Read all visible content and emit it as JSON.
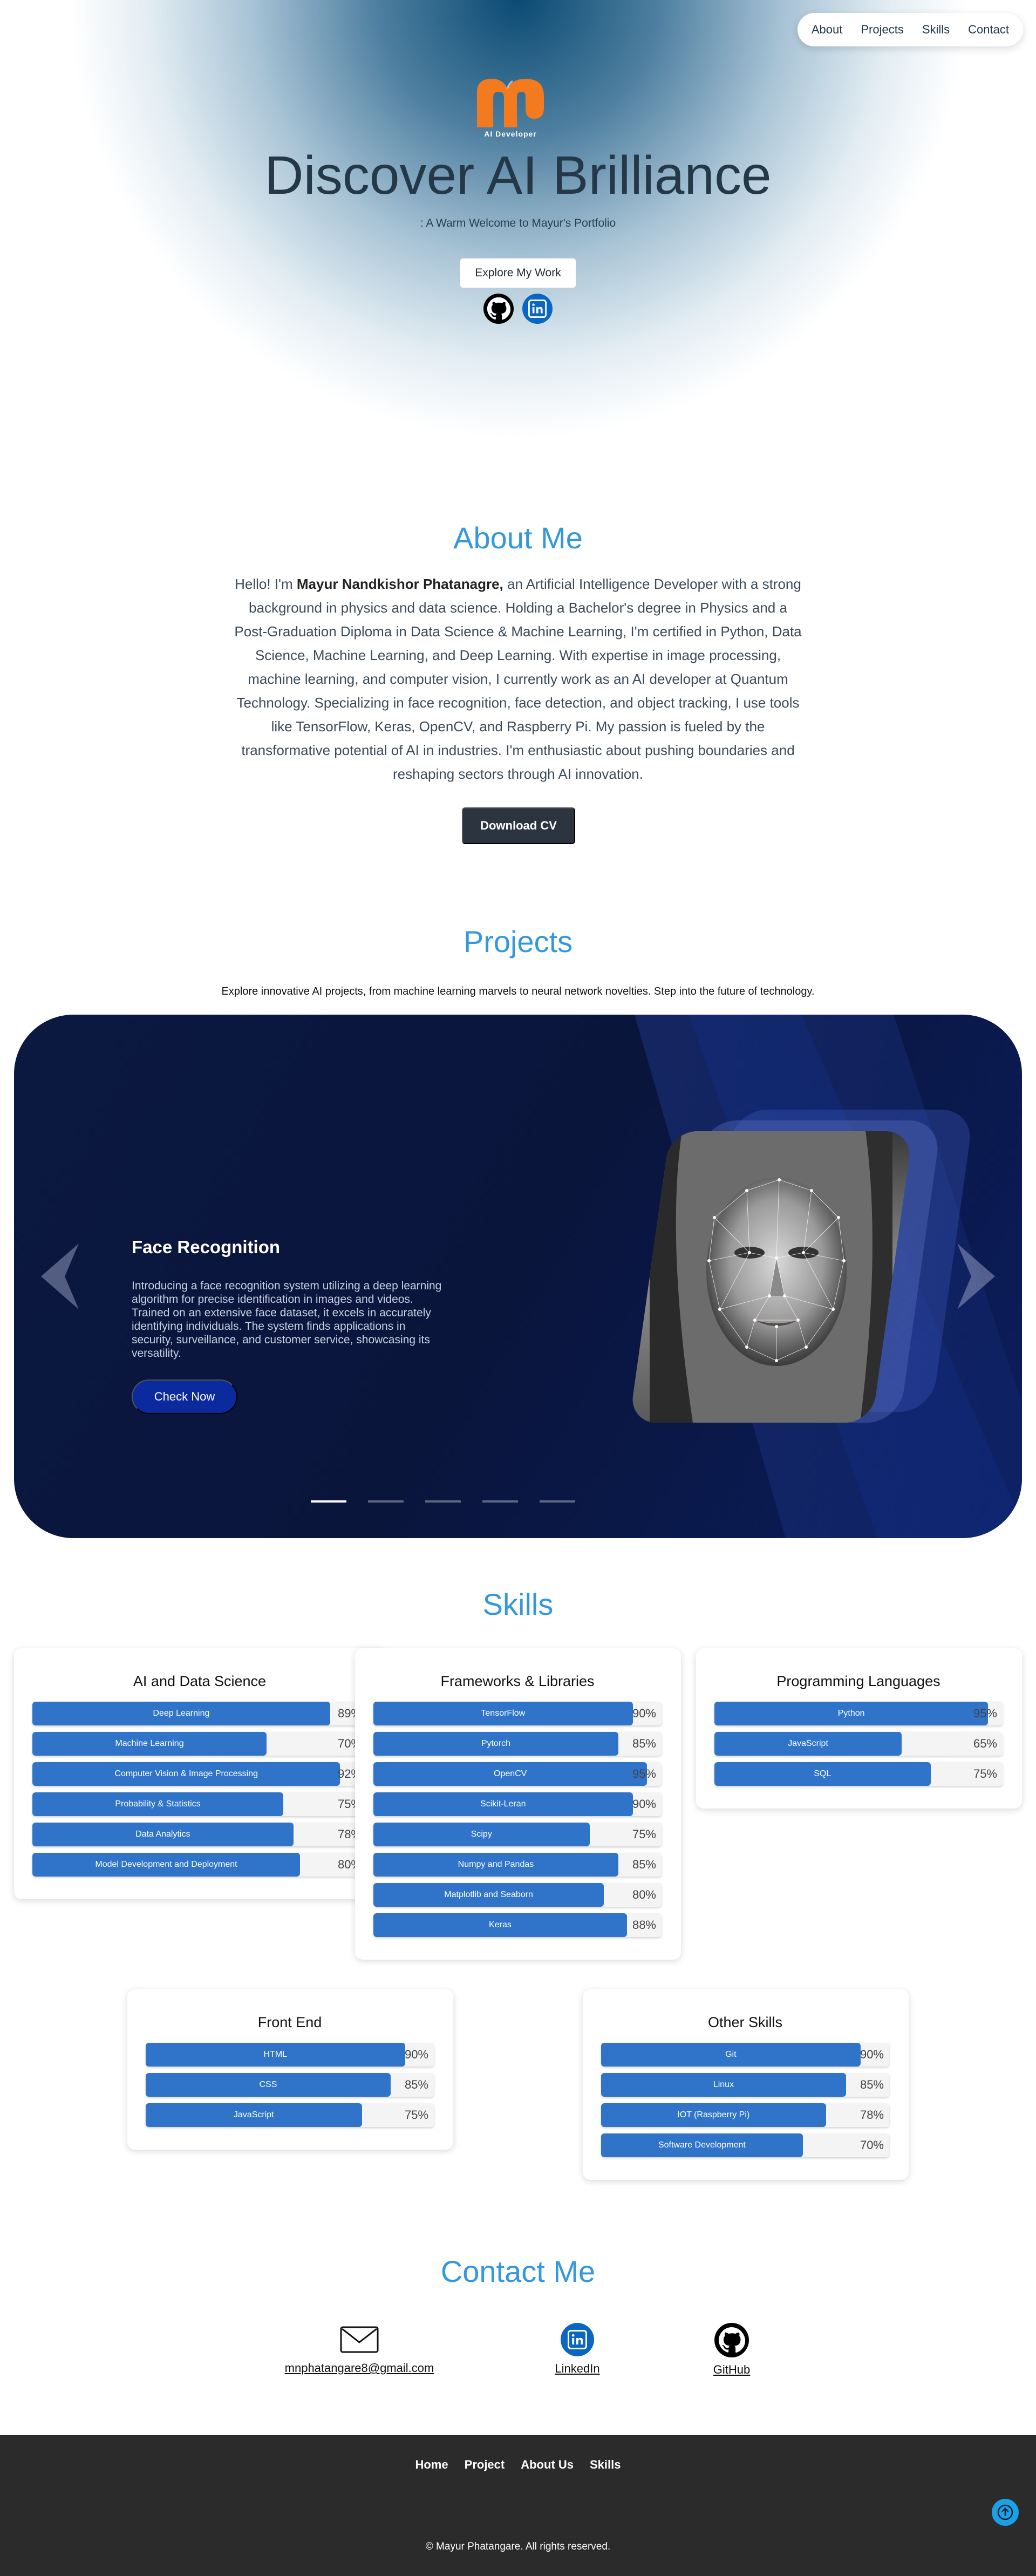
{
  "nav": {
    "items": [
      "About",
      "Projects",
      "Skills",
      "Contact"
    ]
  },
  "hero": {
    "logo_text": "AI Developer",
    "title": "Discover AI Brilliance",
    "subtitle": ": A Warm Welcome to Mayur's Portfolio",
    "button": "Explore My Work",
    "social_icons": [
      "github-icon",
      "linkedin-icon"
    ]
  },
  "about": {
    "title": "About Me",
    "intro": "Hello! I'm ",
    "name": "Mayur Nandkishor Phatanagre,",
    "body": " an Artificial Intelligence Developer with a strong background in physics and data science. Holding a Bachelor's degree in Physics and a Post-Graduation Diploma in Data Science & Machine Learning, I'm certified in Python, Data Science, Machine Learning, and Deep Learning. With expertise in image processing, machine learning, and computer vision, I currently work as an AI developer at Quantum Technology. Specializing in face recognition, face detection, and object tracking, I use tools like TensorFlow, Keras, OpenCV, and Raspberry Pi. My passion is fueled by the transformative potential of AI in industries. I'm enthusiastic about pushing boundaries and reshaping sectors through AI innovation.",
    "button": "Download CV"
  },
  "projects": {
    "title": "Projects",
    "subtitle": "Explore innovative AI projects, from machine learning marvels to neural network novelties. Step into the future of technology.",
    "slide": {
      "title": "Face Recognition",
      "description": "Introducing a face recognition system utilizing a deep learning algorithm for precise identification in images and videos. Trained on an extensive face dataset, it excels in accurately identifying individuals. The system finds applications in security, surveillance, and customer service, showcasing its versatility.",
      "button": "Check Now"
    },
    "dots": 5,
    "active_dot": 0
  },
  "skills": {
    "title": "Skills",
    "bar_color": "#2f74c8",
    "groups": [
      {
        "title": "AI and Data Science",
        "items": [
          {
            "label": "Deep Learning",
            "pct": "89%",
            "value": 89
          },
          {
            "label": "Machine Learning",
            "pct": "70%",
            "value": 70
          },
          {
            "label": "Computer Vision & Image Processing",
            "pct": "92%",
            "value": 92
          },
          {
            "label": "Probability & Statistics",
            "pct": "75%",
            "value": 75
          },
          {
            "label": "Data Analytics",
            "pct": "78%",
            "value": 78
          },
          {
            "label": "Model Development and Deployment",
            "pct": "80%",
            "value": 80
          }
        ]
      },
      {
        "title": "Frameworks & Libraries",
        "items": [
          {
            "label": "TensorFlow",
            "pct": "90%",
            "value": 90
          },
          {
            "label": "Pytorch",
            "pct": "85%",
            "value": 85
          },
          {
            "label": "OpenCV",
            "pct": "95%",
            "value": 95
          },
          {
            "label": "Scikit-Leran",
            "pct": "90%",
            "value": 90
          },
          {
            "label": "Scipy",
            "pct": "75%",
            "value": 75
          },
          {
            "label": "Numpy and Pandas",
            "pct": "85%",
            "value": 85
          },
          {
            "label": "Matplotlib and Seaborn",
            "pct": "80%",
            "value": 80
          },
          {
            "label": "Keras",
            "pct": "88%",
            "value": 88
          }
        ]
      },
      {
        "title": "Programming Languages",
        "items": [
          {
            "label": "Python",
            "pct": "95%",
            "value": 95
          },
          {
            "label": "JavaScript",
            "pct": "65%",
            "value": 65
          },
          {
            "label": "SQL",
            "pct": "75%",
            "value": 75
          }
        ]
      },
      {
        "title": "Front End",
        "items": [
          {
            "label": "HTML",
            "pct": "90%",
            "value": 90
          },
          {
            "label": "CSS",
            "pct": "85%",
            "value": 85
          },
          {
            "label": "JavaScript",
            "pct": "75%",
            "value": 75
          }
        ]
      },
      {
        "title": "Other Skills",
        "items": [
          {
            "label": "Git",
            "pct": "90%",
            "value": 90
          },
          {
            "label": "Linux",
            "pct": "85%",
            "value": 85
          },
          {
            "label": "IOT (Raspberry Pi)",
            "pct": "78%",
            "value": 78
          },
          {
            "label": "Software Development",
            "pct": "70%",
            "value": 70
          }
        ]
      }
    ]
  },
  "contact": {
    "title": "Contact Me",
    "email": "mnphatangare8@gmail.com",
    "linkedin": "LinkedIn",
    "github": "GitHub"
  },
  "footer": {
    "links": [
      "Home",
      "Project",
      "About Us",
      "Skills"
    ],
    "copyright": "© Mayur Phatangare. All rights reserved."
  }
}
